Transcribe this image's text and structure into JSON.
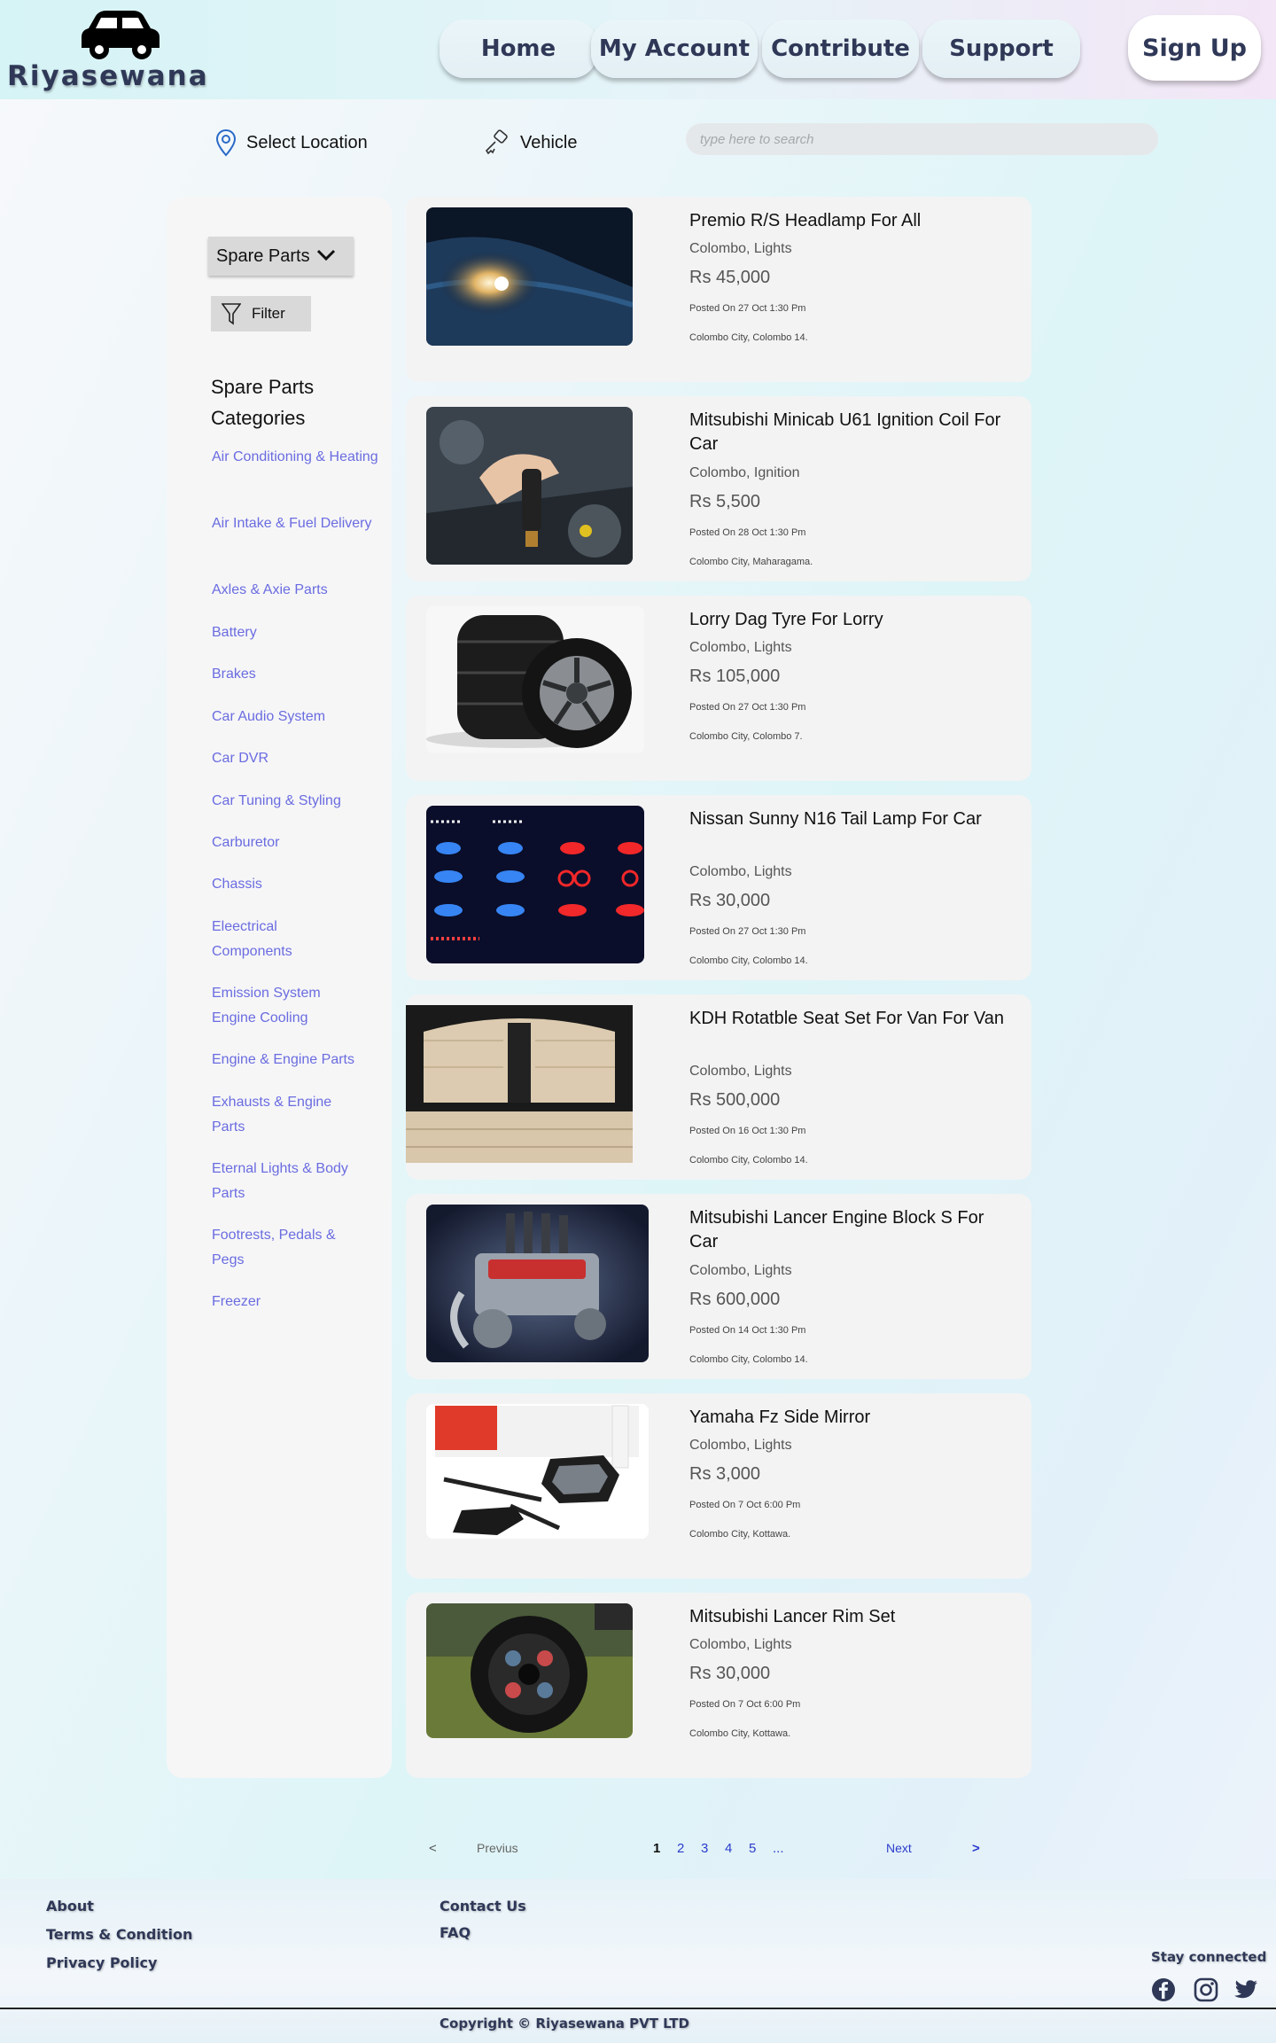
{
  "header": {
    "brand": "Riyasewana",
    "nav": [
      "Home",
      "My Account",
      "Contribute",
      "Support"
    ],
    "signup_label": "Sign Up"
  },
  "subbar": {
    "location_label": "Select Location",
    "vehicle_label": "Vehicle",
    "search_placeholder": "type here to search"
  },
  "sidebar": {
    "dropdown_label": "Spare Parts",
    "filter_label": "Filter",
    "categories_title": "Spare Parts Categories",
    "categories": [
      "Air Conditioning & Heating",
      "Air Intake & Fuel Delivery",
      "Axles & Axie Parts",
      "Battery",
      "Brakes",
      "Car Audio System",
      "Car DVR",
      "Car Tuning & Styling",
      "Carburetor",
      "Chassis",
      "Eleectrical Components",
      "Emission System Engine Cooling",
      "Engine & Engine Parts",
      "Exhausts & Engine Parts",
      "Eternal Lights & Body Parts",
      "Footrests, Pedals & Pegs",
      "Freezer"
    ]
  },
  "listings": [
    {
      "title": "Premio R/S Headlamp For All",
      "meta": "Colombo, Lights",
      "price": "Rs 45,000",
      "posted": "Posted On 27 Oct 1:30 Pm",
      "place": "Colombo City, Colombo 14.",
      "image": "headlamp"
    },
    {
      "title": "Mitsubishi Minicab U61 Ignition Coil For Car",
      "meta": "Colombo, Ignition",
      "price": "Rs 5,500",
      "posted": "Posted On 28 Oct 1:30 Pm",
      "place": "Colombo City, Maharagama.",
      "image": "ignition-coil"
    },
    {
      "title": "Lorry Dag Tyre For Lorry",
      "meta": "Colombo, Lights",
      "price": "Rs 105,000",
      "posted": "Posted On 27 Oct 1:30 Pm",
      "place": "Colombo City, Colombo 7.",
      "image": "tyres"
    },
    {
      "title": "Nissan Sunny N16 Tail Lamp For Car",
      "meta": "Colombo, Lights",
      "price": "Rs 30,000",
      "posted": "Posted On 27 Oct 1:30 Pm",
      "place": "Colombo City, Colombo 14.",
      "image": "tail-lamps"
    },
    {
      "title": "KDH Rotatble Seat Set For Van For Van",
      "meta": "Colombo, Lights",
      "price": "Rs 500,000",
      "posted": "Posted On 16 Oct 1:30 Pm",
      "place": "Colombo City, Colombo 14.",
      "image": "seat"
    },
    {
      "title": "Mitsubishi Lancer Engine Block S For Car",
      "meta": "Colombo, Lights",
      "price": "Rs 600,000",
      "posted": "Posted On 14 Oct 1:30 Pm",
      "place": "Colombo City, Colombo 14.",
      "image": "engine"
    },
    {
      "title": "Yamaha Fz Side Mirror",
      "meta": "Colombo, Lights",
      "price": "Rs 3,000",
      "posted": "Posted On 7 Oct 6:00 Pm",
      "place": "Colombo City, Kottawa.",
      "image": "mirror"
    },
    {
      "title": "Mitsubishi Lancer Rim Set",
      "meta": "Colombo, Lights",
      "price": "Rs 30,000",
      "posted": "Posted On 7 Oct 6:00 Pm",
      "place": "Colombo City, Kottawa.",
      "image": "rim"
    }
  ],
  "pagination": {
    "prev_arrow": "<",
    "prev_label": "Previus",
    "pages": [
      "1",
      "2",
      "3",
      "4",
      "5",
      "..."
    ],
    "current": "1",
    "next_label": "Next",
    "next_arrow": ">"
  },
  "footer": {
    "about": "About",
    "terms": "Terms & Condition",
    "privacy": "Privacy Policy",
    "contact": "Contact Us",
    "faq": "FAQ",
    "stay_connected": "Stay connected",
    "copyright": "Copyright © Riyasewana PVT LTD",
    "social_icons": [
      "facebook-icon",
      "instagram-icon",
      "twitter-icon"
    ]
  },
  "colors": {
    "brand_navy": "#2f3857",
    "category_link": "#6a6ce0",
    "page_link": "#2c3ccc"
  }
}
